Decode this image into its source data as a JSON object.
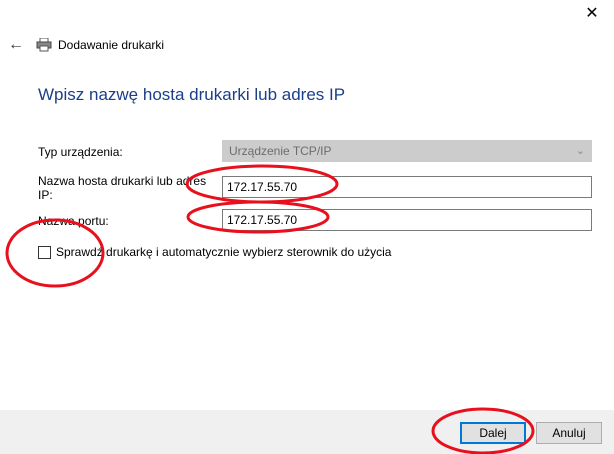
{
  "window": {
    "title": "Dodawanie drukarki",
    "close_glyph": "✕",
    "back_glyph": "←"
  },
  "heading": "Wpisz nazwę hosta drukarki lub adres IP",
  "form": {
    "device_type_label": "Typ urządzenia:",
    "device_type_value": "Urządzenie TCP/IP",
    "host_label_line1": "Nazwa hosta drukarki lub adres",
    "host_label_line2": "IP:",
    "host_value": "172.17.55.70",
    "port_label": "Nazwa portu:",
    "port_value": "172.17.55.70",
    "checkbox_label": "Sprawdź drukarkę i automatycznie wybierz sterownik do użycia",
    "checkbox_checked": false
  },
  "buttons": {
    "next": "Dalej",
    "cancel": "Anuluj"
  },
  "colors": {
    "heading": "#1b3e8a",
    "annotation": "#e8101c",
    "focus": "#0078d7"
  }
}
